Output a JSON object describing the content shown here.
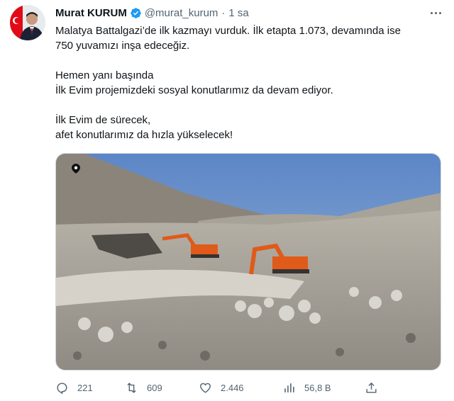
{
  "author": {
    "name": "Murat KURUM",
    "handle": "@murat_kurum",
    "separator": "·",
    "time": "1 sa"
  },
  "tweet": {
    "paragraphs": [
      [
        "Malatya Battalgazi’de ilk kazmayı vurduk. İlk etapta 1.073, devamında ise",
        "750 yuvamızı inşa edeceğiz."
      ],
      [
        "Hemen yanı başında",
        "İlk Evim projemizdeki sosyal konutlarımız da devam ediyor."
      ],
      [
        "İlk Evim de sürecek,",
        "afet konutlarımız da hızla yükselecek!"
      ]
    ]
  },
  "media": {
    "icon": "location-pin-icon"
  },
  "actions": {
    "replies": "221",
    "retweets": "609",
    "likes": "2.446",
    "views": "56,8 B"
  },
  "colors": {
    "text": "#0f1419",
    "secondary": "#536471",
    "verified": "#1d9bf0"
  }
}
